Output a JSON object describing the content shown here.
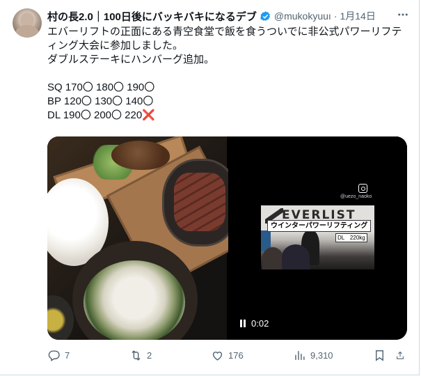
{
  "post": {
    "author_name": "村の長2.0｜100日後にバッキバキになるデブ",
    "handle": "@mukokyuuı",
    "separator": "·",
    "date": "1月14日",
    "text_lines": [
      "エバーリフトの正面にある青空食堂で飯を食うついでに非公式パワーリフテ",
      "ィング大会に参加しました。",
      "ダブルステーキにハンバーグ追加。",
      "",
      "SQ 170〇 180〇 190〇",
      "BP 120〇 130〇 140〇",
      "DL 190〇 200〇 220"
    ],
    "cross_mark": "❌"
  },
  "video": {
    "caption_title": "ウインターパワーリフティング",
    "caption_lift": "DL　220kg",
    "overlay_handle": "@uezo_naoko",
    "logo_text": "EVERLIST",
    "time": "0:02"
  },
  "actions": {
    "replies": "7",
    "reposts": "2",
    "likes": "176",
    "views": "9,310"
  },
  "colors": {
    "verified_blue": "#1d9bf0",
    "muted_text": "#536471",
    "cross_red": "#e2293f"
  },
  "icons": [
    "verified-badge-icon",
    "more-icon",
    "reply-icon",
    "repost-icon",
    "like-icon",
    "views-icon",
    "bookmark-icon",
    "share-icon",
    "pause-icon",
    "instagram-icon"
  ]
}
